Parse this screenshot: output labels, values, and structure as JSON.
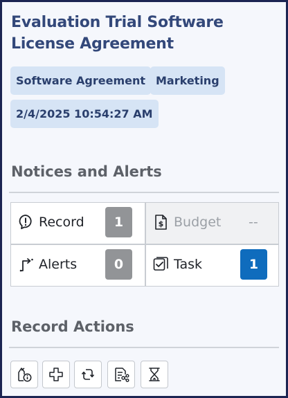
{
  "header": {
    "title": "Evaluation Trial Software License Agreement",
    "tags": [
      "Software Agreement",
      "Marketing",
      "2/4/2025 10:54:27 AM"
    ]
  },
  "notices": {
    "title": "Notices and Alerts",
    "cards": [
      {
        "label": "Record",
        "count": "1",
        "icon": "alert-circle-icon",
        "enabled": true
      },
      {
        "label": "Budget",
        "count": "--",
        "icon": "budget-icon",
        "enabled": false
      },
      {
        "label": "Alerts",
        "count": "0",
        "icon": "alerts-arrow-icon",
        "enabled": true
      },
      {
        "label": "Task",
        "count": "1",
        "icon": "task-icon",
        "enabled": true
      }
    ]
  },
  "record_actions": {
    "title": "Record Actions",
    "buttons": [
      {
        "icon": "document-info-icon"
      },
      {
        "icon": "add-icon"
      },
      {
        "icon": "sync-icon"
      },
      {
        "icon": "workflow-list-icon"
      },
      {
        "icon": "hourglass-icon"
      }
    ]
  },
  "colors": {
    "title": "#33487a",
    "tag_bg": "#d6e4f5",
    "badge_grey": "#929497",
    "badge_blue": "#0f6cbd",
    "frame": "#1b2452"
  }
}
